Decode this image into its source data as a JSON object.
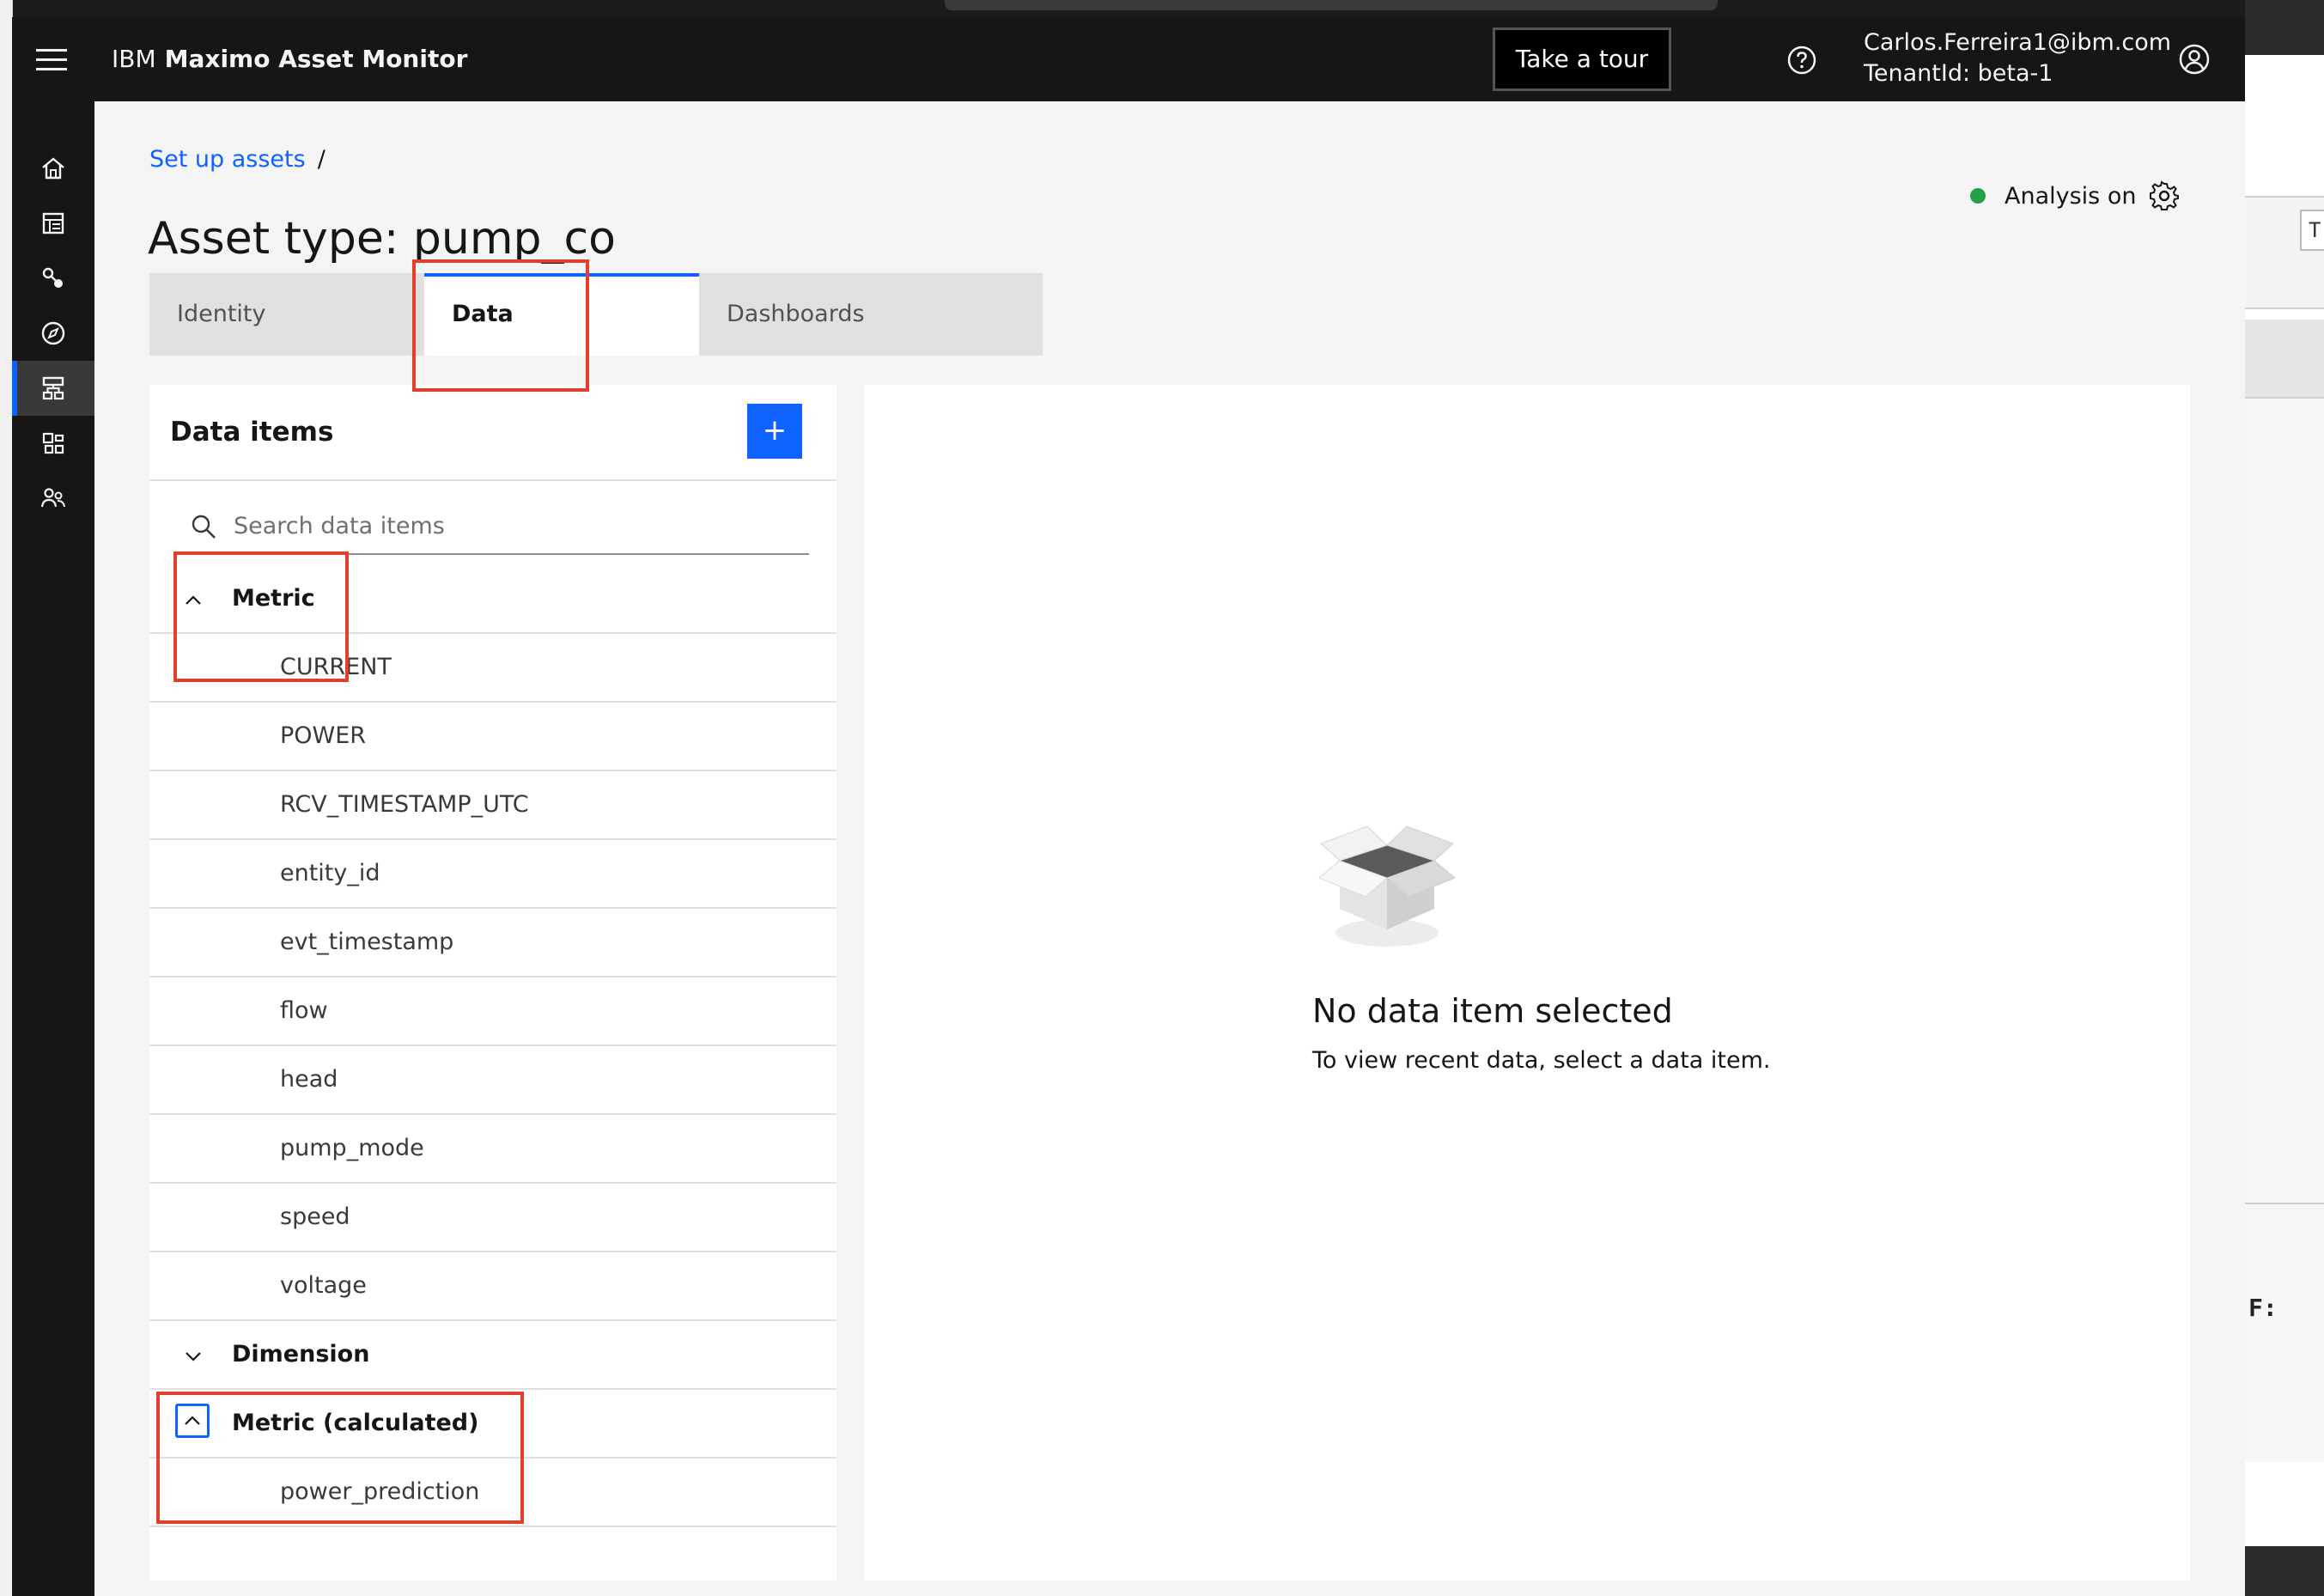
{
  "header": {
    "brand_prefix": "IBM",
    "brand_name": "Maximo Asset Monitor",
    "tour_button": "Take a tour",
    "user_email": "Carlos.Ferreira1@ibm.com",
    "tenant": "TenantId: beta-1"
  },
  "rail": {
    "items": [
      "home-icon",
      "dashboard-icon",
      "connect-icon",
      "monitor-icon",
      "asset-hierarchy-icon",
      "widgets-icon",
      "users-icon"
    ],
    "active_index": 4
  },
  "breadcrumb": {
    "link": "Set up assets",
    "separator": "/"
  },
  "page_title": "Asset type: pump_co",
  "status": {
    "label": "Analysis on",
    "color": "#24a148"
  },
  "tabs": [
    {
      "label": "Identity",
      "selected": false
    },
    {
      "label": "Data",
      "selected": true
    },
    {
      "label": "Dashboards",
      "selected": false
    }
  ],
  "data_panel": {
    "title": "Data items",
    "add_button": "+",
    "search_placeholder": "Search data items",
    "groups": [
      {
        "label": "Metric",
        "expanded": true,
        "items": [
          "CURRENT",
          "POWER",
          "RCV_TIMESTAMP_UTC",
          "entity_id",
          "evt_timestamp",
          "flow",
          "head",
          "pump_mode",
          "speed",
          "voltage"
        ]
      },
      {
        "label": "Dimension",
        "expanded": false,
        "items": []
      },
      {
        "label": "Metric (calculated)",
        "expanded": true,
        "items": [
          "power_prediction"
        ]
      }
    ]
  },
  "empty_state": {
    "title": "No data item selected",
    "subtitle": "To view recent data, select a data item."
  },
  "background": {
    "fragment_t": "T",
    "fragment_f": "F:"
  },
  "colors": {
    "accent": "#0f62fe",
    "header_bg": "#161616",
    "annotation": "#e0402e"
  }
}
